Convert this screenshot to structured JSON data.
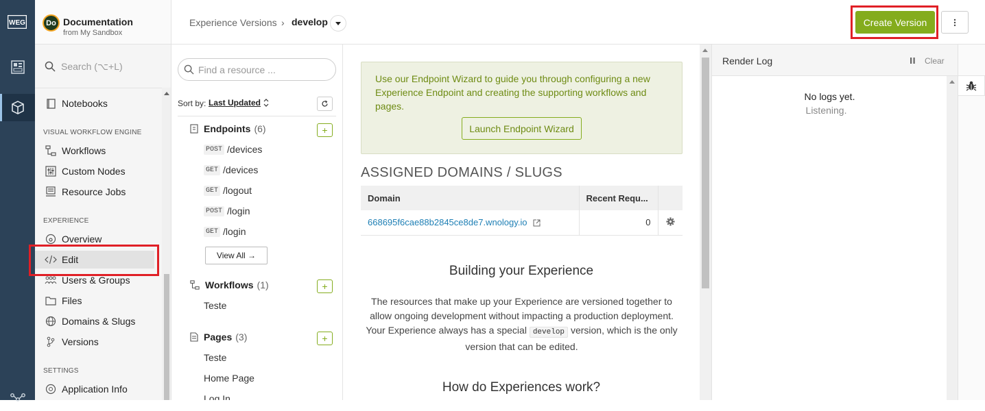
{
  "rail": {
    "logo_text": "WEG",
    "items": [
      {
        "icon": "dashboard-icon"
      },
      {
        "icon": "cube-icon",
        "active": true
      },
      {
        "icon": "workflow-nodes-icon"
      }
    ]
  },
  "app": {
    "avatar_text": "Do",
    "name": "Documentation",
    "subtitle": "from My Sandbox"
  },
  "sidebar": {
    "search_placeholder": "Search (⌥+L)",
    "top_items": [
      {
        "label": "Notebooks",
        "icon": "notebook-icon"
      }
    ],
    "sections": [
      {
        "title": "VISUAL WORKFLOW ENGINE",
        "items": [
          {
            "label": "Workflows",
            "icon": "workflow-icon"
          },
          {
            "label": "Custom Nodes",
            "icon": "sliders-icon"
          },
          {
            "label": "Resource Jobs",
            "icon": "jobs-icon"
          }
        ]
      },
      {
        "title": "EXPERIENCE",
        "items": [
          {
            "label": "Overview",
            "icon": "overview-icon"
          },
          {
            "label": "Edit",
            "icon": "code-icon",
            "active": true
          },
          {
            "label": "Users & Groups",
            "icon": "users-icon"
          },
          {
            "label": "Files",
            "icon": "folder-icon"
          },
          {
            "label": "Domains & Slugs",
            "icon": "globe-icon"
          },
          {
            "label": "Versions",
            "icon": "branch-icon"
          }
        ]
      },
      {
        "title": "SETTINGS",
        "items": [
          {
            "label": "Application Info",
            "icon": "info-icon"
          }
        ]
      }
    ]
  },
  "topbar": {
    "breadcrumb_parent": "Experience Versions",
    "breadcrumb_sep": "›",
    "breadcrumb_current": "develop",
    "create_version_label": "Create Version"
  },
  "resources": {
    "search_placeholder": "Find a resource ...",
    "sort_label": "Sort by:",
    "sort_value": "Last Updated",
    "view_all_label": "View All →",
    "groups": [
      {
        "name": "Endpoints",
        "count": "(6)",
        "items": [
          {
            "method": "POST",
            "path": "/devices"
          },
          {
            "method": "GET",
            "path": "/devices"
          },
          {
            "method": "GET",
            "path": "/logout"
          },
          {
            "method": "POST",
            "path": "/login"
          },
          {
            "method": "GET",
            "path": "/login"
          }
        ]
      },
      {
        "name": "Workflows",
        "count": "(1)",
        "items": [
          {
            "label": "Teste"
          }
        ]
      },
      {
        "name": "Pages",
        "count": "(3)",
        "items": [
          {
            "label": "Teste"
          },
          {
            "label": "Home Page"
          },
          {
            "label": "Log In"
          }
        ]
      }
    ]
  },
  "main": {
    "wizard_text": "Use our Endpoint Wizard to guide you through configuring a new Experience Endpoint and creating the supporting workflows and pages.",
    "wizard_button": "Launch Endpoint Wizard",
    "assigned_title": "ASSIGNED DOMAINS / SLUGS",
    "table": {
      "headers": [
        "Domain",
        "Recent Requ..."
      ],
      "rows": [
        {
          "domain": "668695f6cae88b2845ce8de7.wnology.io",
          "requests": "0"
        }
      ]
    },
    "building_title": "Building your Experience",
    "building_text_1": "The resources that make up your Experience are versioned together to allow ongoing development without impacting a production deployment. Your Experience always has a special",
    "building_code": "develop",
    "building_text_2": "version, which is the only version that can be edited.",
    "how_title": "How do Experiences work?"
  },
  "render_log": {
    "title": "Render Log",
    "pause_glyph": "⏸",
    "clear_label": "Clear",
    "empty_text": "No logs yet.",
    "listening_text": "Listening."
  },
  "colors": {
    "accent": "#84ac1d",
    "highlight": "#e01f26",
    "rail": "#2c4258",
    "link": "#1e7fb5"
  }
}
